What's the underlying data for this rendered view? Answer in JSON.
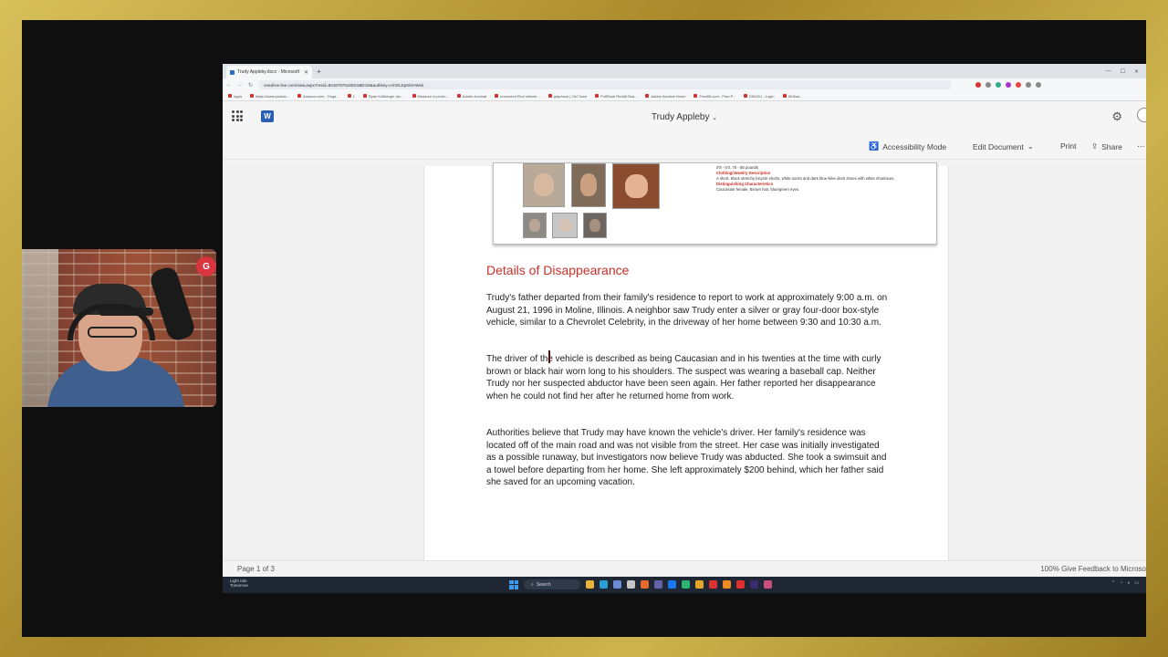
{
  "browser": {
    "tab_title": "Trudy Appleby.docx - Microsoft",
    "url": "onedrive.live.com/view.aspx?resid=8418787918DC68D!18&authkey=!AhOLEpKbrHWck",
    "bookmarks": [
      "Apps",
      "https://www.youtub...",
      "Amazon.com - Sega...",
      "1",
      "Ryan Kollberger (dc...",
      "Measure in photo...",
      "Adobe Acrobat",
      "recovered Find vehicle...",
      "graphuse | Old Town",
      "PollRush Reddit Sea...",
      "Adobe Acrobat Home",
      "Free80.com - Free P...",
      "DMV2U - Login",
      "All Boo..."
    ]
  },
  "word": {
    "doc_title": "Trudy Appleby",
    "commands": {
      "accessibility": "Accessibility Mode",
      "edit": "Edit Document",
      "print": "Print",
      "share": "Share"
    }
  },
  "poster": {
    "info_line1": "4'8 - 5'0, 75 - 85 pounds",
    "clothing_heading": "Clothing/Jewelry Description",
    "clothing_text": "A short, black stretchy bicycle shorts, white socks and dark blue Nike deck shoes with white shoelaces.",
    "characteristics_heading": "Distinguishing Characteristics",
    "characteristics_text": "Caucasian female. Brown hair, blue/green eyes."
  },
  "document": {
    "heading": "Details of Disappearance",
    "paragraphs": [
      "Trudy's father departed from their family's residence to report to work at approximately 9:00 a.m. on August 21, 1996 in Moline, Illinois. A neighbor saw Trudy enter a silver or gray four-door box-style vehicle, similar to a Chevrolet Celebrity, in the driveway of her home between 9:30 and 10:30 a.m.",
      "The driver of the vehicle is described as being Caucasian and in his twenties at the time with curly brown or black hair worn long to his shoulders. The suspect was wearing a baseball cap. Neither Trudy nor her suspected abductor have been seen again. Her father reported her disappearance when he could not find her after he returned home from work.",
      "Authorities believe that Trudy may have known the vehicle's driver. Her family's residence was located off of the main road and was not visible from the street. Her case was initially investigated as a possible runaway, but investigators now believe Trudy was abducted. She took a swimsuit and a towel before departing from her home. She left approximately $200 behind, which her father said she saved for an upcoming vacation."
    ]
  },
  "status": {
    "page": "Page 1 of 3",
    "zoom": "100%",
    "feedback": "Give Feedback to Microso"
  },
  "taskbar": {
    "weather": "Light rain",
    "weather_sub": "Tomorrow",
    "search": "Search"
  },
  "webcam": {
    "logo": "G"
  }
}
